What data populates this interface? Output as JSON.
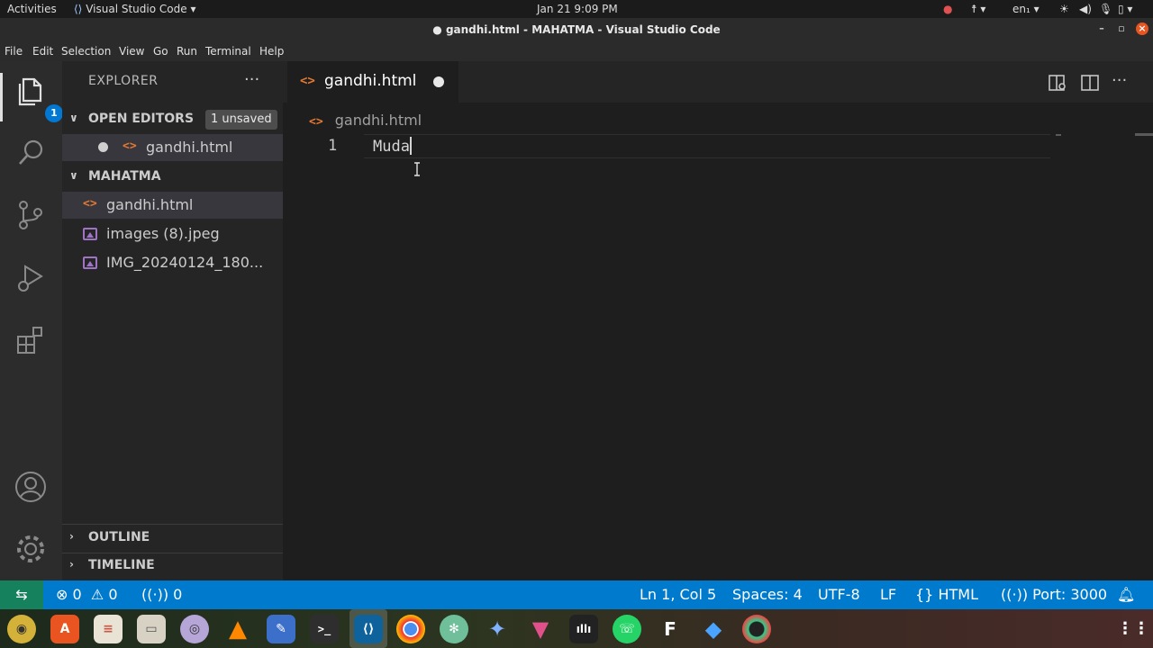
{
  "topbar": {
    "activities": "Activities",
    "app_menu": "Visual Studio Code",
    "clock": "Jan 21  9:09 PM",
    "language": "en₁"
  },
  "window": {
    "title": "● gandhi.html - MAHATMA - Visual Studio Code"
  },
  "menu": [
    "File",
    "Edit",
    "Selection",
    "View",
    "Go",
    "Run",
    "Terminal",
    "Help"
  ],
  "activitybar": {
    "explorer_badge": "1"
  },
  "sidebar": {
    "title": "EXPLORER",
    "more": "···",
    "open_editors": {
      "label": "OPEN EDITORS",
      "badge": "1 unsaved",
      "items": [
        {
          "name": "gandhi.html"
        }
      ]
    },
    "folder": {
      "label": "MAHATMA",
      "items": [
        {
          "name": "gandhi.html",
          "type": "html-file-icon"
        },
        {
          "name": "images (8).jpeg",
          "type": "image-file-icon"
        },
        {
          "name": "IMG_20240124_180...",
          "type": "image-file-icon"
        }
      ]
    },
    "outline": "OUTLINE",
    "timeline": "TIMELINE"
  },
  "editor": {
    "tab_label": "gandhi.html",
    "breadcrumb": "gandhi.html",
    "line_number": "1",
    "code": "Muda"
  },
  "statusbar": {
    "errors": "0",
    "warnings": "0",
    "ports_forwarded": "0",
    "position": "Ln 1, Col 5",
    "spaces": "Spaces: 4",
    "encoding": "UTF-8",
    "eol": "LF",
    "language": "HTML",
    "port": "Port: 3000"
  },
  "colors": {
    "accent": "#007acc",
    "remote": "#16825d",
    "html_icon": "#e37933",
    "image_icon": "#a074c4"
  }
}
